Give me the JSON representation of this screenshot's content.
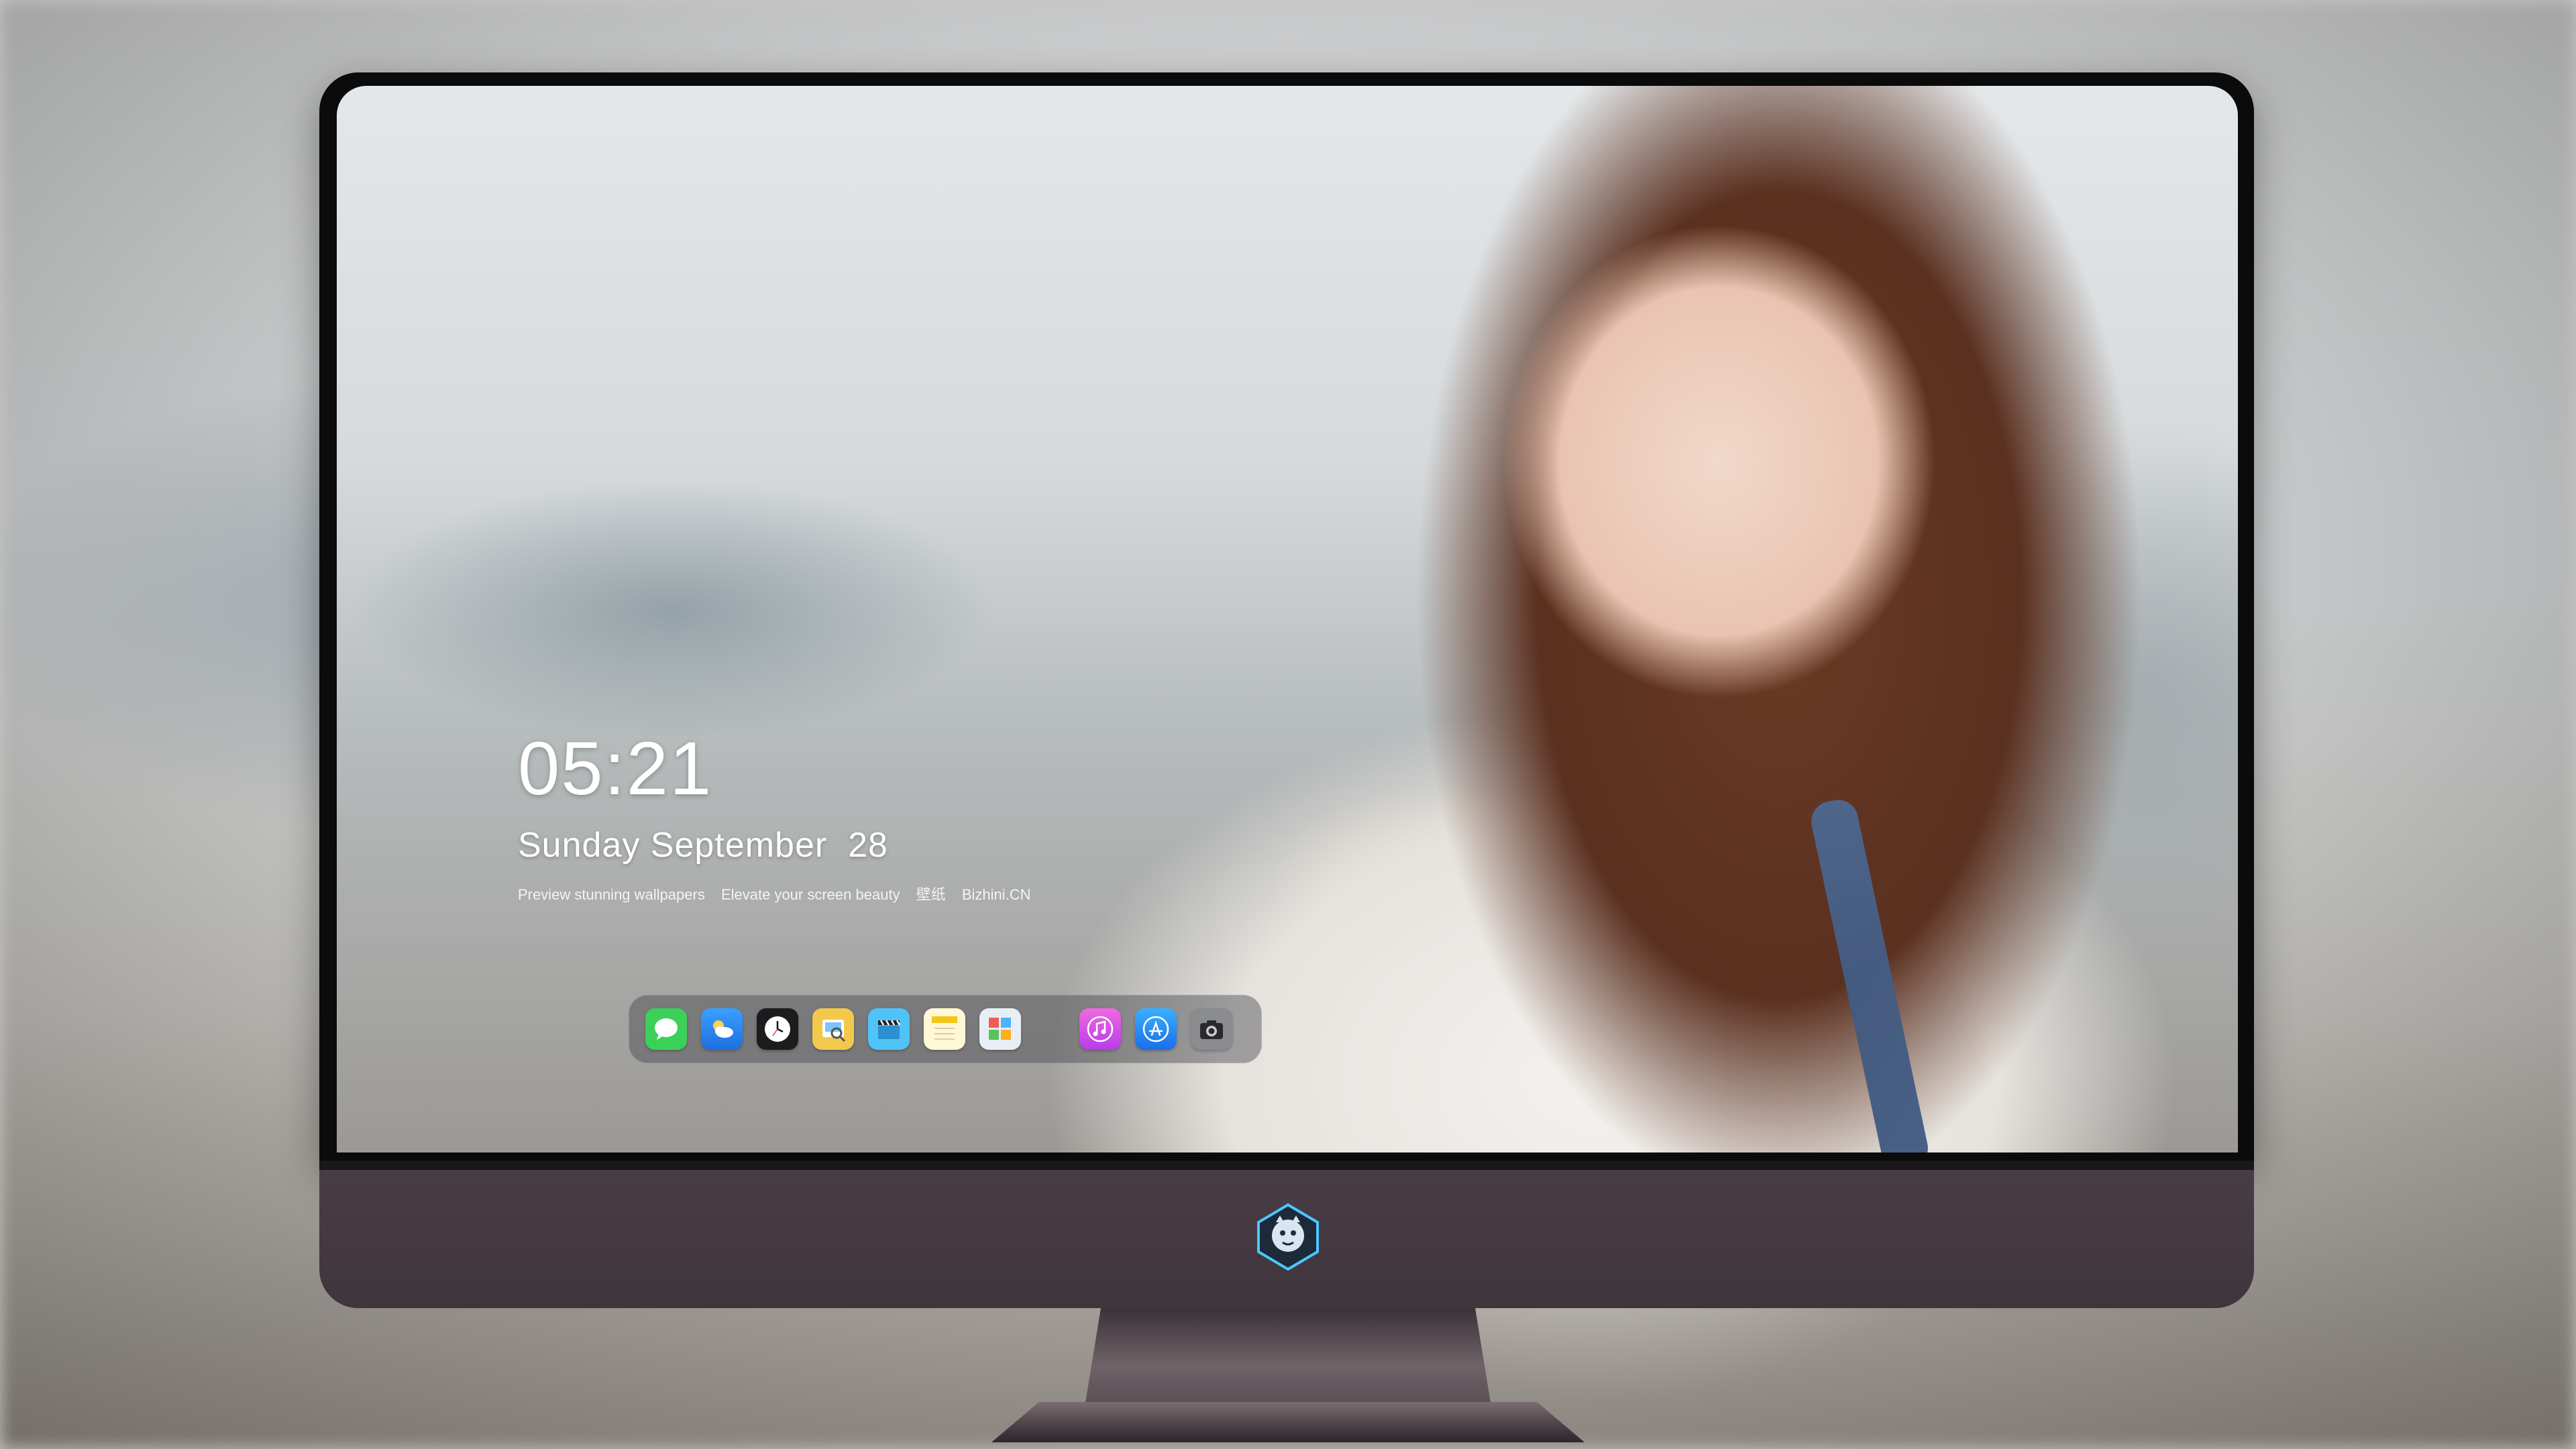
{
  "lockscreen": {
    "time": "05:21",
    "date": "Sunday September  28",
    "tagline": [
      "Preview stunning wallpapers",
      "Elevate your screen beauty",
      "壁纸",
      "Bizhini.CN"
    ]
  },
  "dock": {
    "apps": [
      {
        "name": "messages-icon",
        "bg": "#3bd159"
      },
      {
        "name": "weather-icon",
        "bg": "#2f8ff0"
      },
      {
        "name": "clock-icon",
        "bg": "#1c1c1e"
      },
      {
        "name": "preview-icon",
        "bg": "#f2c94c"
      },
      {
        "name": "clapper-icon",
        "bg": "#4fc3f7"
      },
      {
        "name": "notes-icon",
        "bg": "#fff7d6"
      },
      {
        "name": "photo-board-icon",
        "bg": "#e8eef5"
      }
    ],
    "apps_right": [
      {
        "name": "itunes-icon",
        "bg": "#e24bd8"
      },
      {
        "name": "app-store-icon",
        "bg": "#1f8ff3"
      },
      {
        "name": "camera-icon",
        "bg": "#8a8c90"
      }
    ]
  },
  "colors": {
    "bezel": "#0b0b0c",
    "chin": "#4a3e46",
    "dock_bg": "rgba(70,70,78,0.45)"
  }
}
